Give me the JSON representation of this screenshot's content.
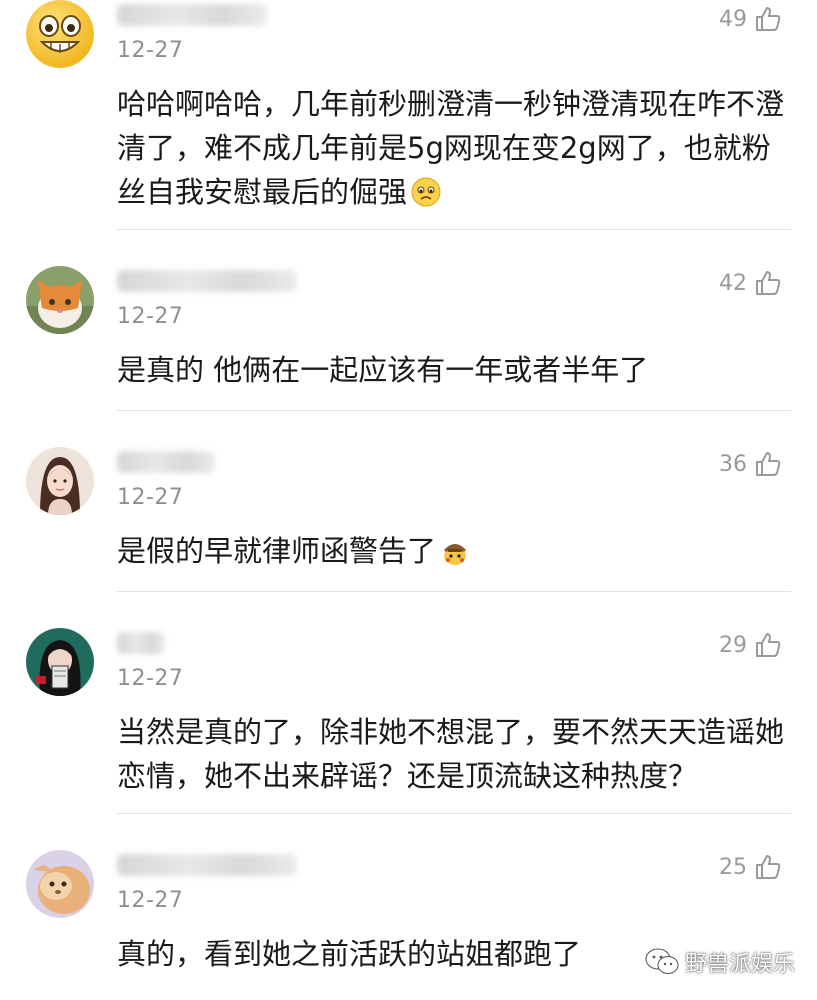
{
  "comments": [
    {
      "date": "12-27",
      "likes": "49",
      "text": "哈哈啊哈哈，几年前秒删澄清一秒钟澄清现在咋不澄清了，难不成几年前是5g网现在变2g网了，也就粉丝自我安慰最后的倔强"
    },
    {
      "date": "12-27",
      "likes": "42",
      "text": "是真的 他俩在一起应该有一年或者半年了"
    },
    {
      "date": "12-27",
      "likes": "36",
      "text": "是假的早就律师函警告了"
    },
    {
      "date": "12-27",
      "likes": "29",
      "text": "当然是真的了，除非她不想混了，要不然天天造谣她恋情，她不出来辟谣？还是顶流缺这种热度？"
    },
    {
      "date": "12-27",
      "likes": "25",
      "text": "真的，看到她之前活跃的站姐都跑了"
    }
  ],
  "watermark": {
    "text": "野兽派娱乐",
    "icon": "wechat-icon"
  },
  "icons": {
    "like": "thumbs-up-icon",
    "avatar_1": "grinning-face-icon"
  },
  "colors": {
    "meta_gray": "#8f8f8f",
    "like_gray": "#9a9a9a",
    "divider": "#e3e3e3"
  }
}
